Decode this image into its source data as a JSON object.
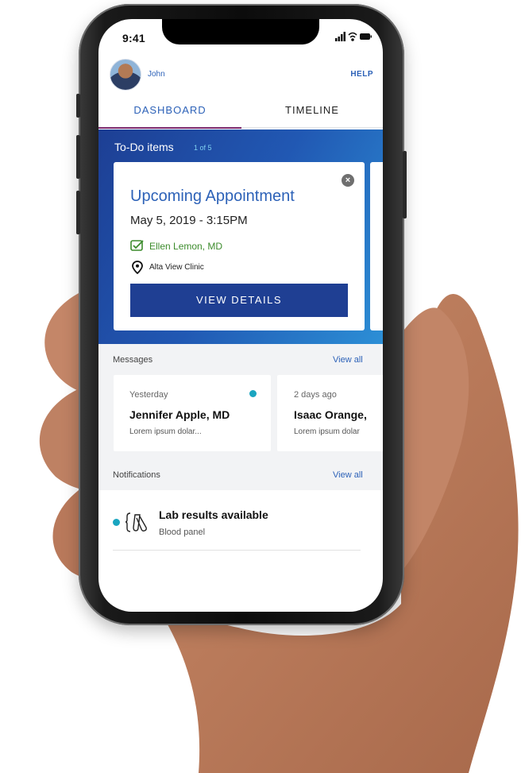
{
  "status_bar": {
    "time": "9:41"
  },
  "header": {
    "user_name": "John",
    "help_label": "HELP"
  },
  "tabs": [
    {
      "label": "DASHBOARD",
      "active": true
    },
    {
      "label": "TIMELINE",
      "active": false
    }
  ],
  "todo": {
    "title": "To-Do items",
    "count": "1 of 5",
    "card": {
      "title": "Upcoming Appointment",
      "datetime": "May 5, 2019 - 3:15PM",
      "doctor": "Ellen Lemon, MD",
      "location": "Alta View Clinic",
      "button_label": "VIEW DETAILS"
    }
  },
  "messages": {
    "label": "Messages",
    "view_all": "View all",
    "items": [
      {
        "when": "Yesterday",
        "name": "Jennifer Apple, MD",
        "preview": "Lorem ipsum dolar...",
        "unread": true
      },
      {
        "when": "2 days ago",
        "name": "Isaac Orange,",
        "preview": "Lorem ipsum dolar",
        "unread": false
      }
    ]
  },
  "notifications": {
    "label": "Notifications",
    "view_all": "View all",
    "items": [
      {
        "title": "Lab results available",
        "subtitle": "Blood panel",
        "unread": true
      }
    ]
  },
  "colors": {
    "brand_blue": "#2d62b8",
    "button_navy": "#1f3f93",
    "accent_teal": "#1aa5c0",
    "doctor_green": "#3d8c2d",
    "tab_underline": "#7d2a6e"
  },
  "icons": [
    "signal-icon",
    "wifi-icon",
    "battery-icon",
    "close-icon",
    "doctor-check-icon",
    "location-pin-icon",
    "lab-tubes-icon"
  ]
}
